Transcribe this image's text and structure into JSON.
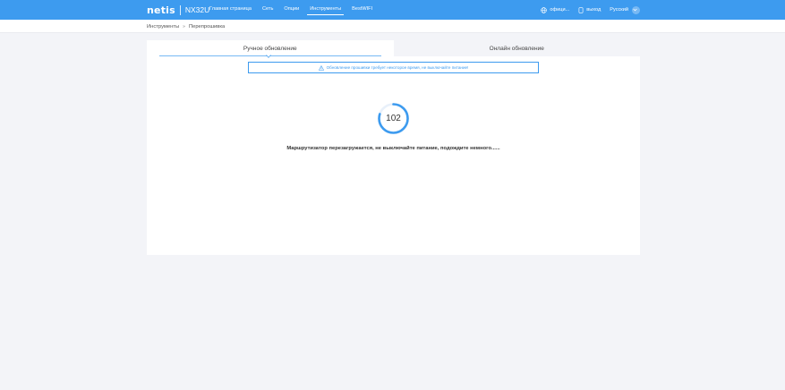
{
  "header": {
    "brand": "netis",
    "model": "NX32U",
    "nav": [
      {
        "label": "Главная страница",
        "active": false
      },
      {
        "label": "Сеть",
        "active": false
      },
      {
        "label": "Опции",
        "active": false
      },
      {
        "label": "Инструменты",
        "active": true
      },
      {
        "label": "BestWIFI",
        "active": false
      }
    ],
    "official_label": "офици...",
    "logout_label": "выход",
    "language": "Русский"
  },
  "breadcrumb": {
    "parent": "Инструменты",
    "separator": "»",
    "current": "Перепрошивка"
  },
  "tabs": [
    {
      "label": "Ручное обновление",
      "active": true
    },
    {
      "label": "Онлайн обновление",
      "active": false
    }
  ],
  "notice": {
    "icon": "warning-icon",
    "text": "Обновление прошивки требует некоторое время, не выключайте питание!"
  },
  "progress": {
    "value": "102",
    "fill_fraction": 0.8
  },
  "status_message": "Маршрутизатор перезагружается, не выключайте питание, подождите немного......",
  "colors": {
    "accent": "#3d9bef",
    "page_bg": "#f3f4f8"
  }
}
